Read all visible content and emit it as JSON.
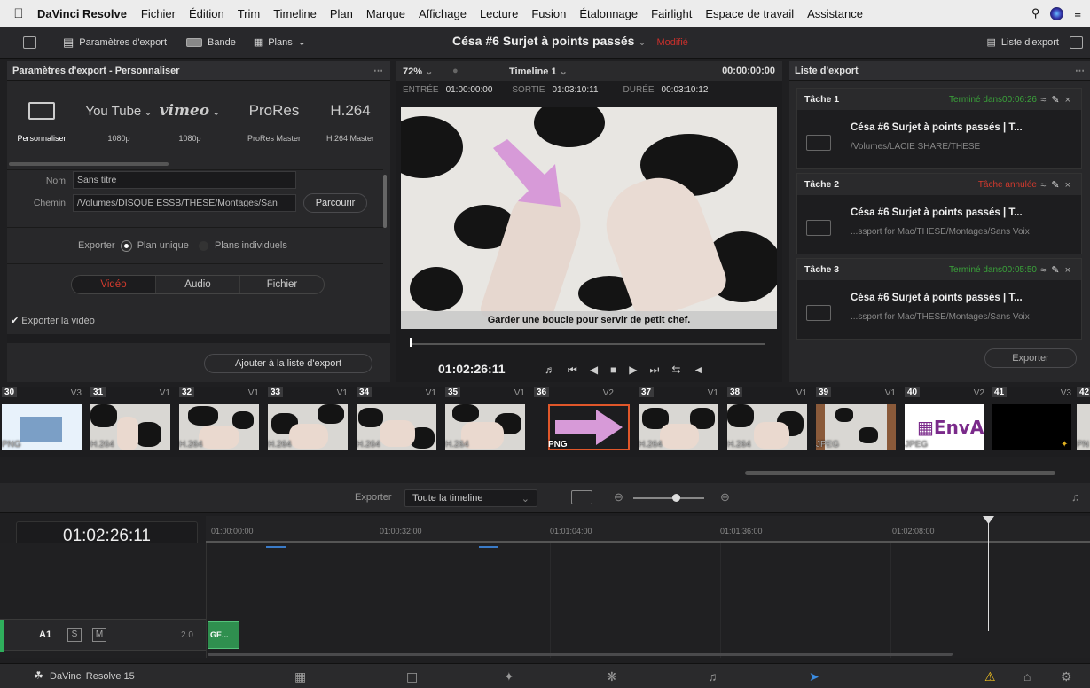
{
  "menubar": {
    "app": "DaVinci Resolve",
    "items": [
      "Fichier",
      "Édition",
      "Trim",
      "Timeline",
      "Plan",
      "Marque",
      "Affichage",
      "Lecture",
      "Fusion",
      "Étalonnage",
      "Fairlight",
      "Espace de travail",
      "Assistance"
    ]
  },
  "toolbar": {
    "export_settings": "Paramètres d'export",
    "tape": "Bande",
    "clips": "Plans",
    "project_title": "Césa #6 Surjet à points passés",
    "modified": "Modifié",
    "export_list": "Liste d'export"
  },
  "left": {
    "header": "Paramètres d'export - Personnaliser",
    "presets": [
      {
        "big": "",
        "small": "Personnaliser"
      },
      {
        "big": "You Tube",
        "small": "1080p"
      },
      {
        "big": "vimeo",
        "small": "1080p"
      },
      {
        "big": "ProRes",
        "small": "ProRes Master"
      },
      {
        "big": "H.264",
        "small": "H.264 Master"
      }
    ],
    "name_label": "Nom",
    "name_value": "Sans titre",
    "path_label": "Chemin",
    "path_value": "/Volumes/DISQUE ESSB/THESE/Montages/San",
    "browse": "Parcourir",
    "export_label": "Exporter",
    "single_clip": "Plan unique",
    "individual_clips": "Plans individuels",
    "tab_video": "Vidéo",
    "tab_audio": "Audio",
    "tab_file": "Fichier",
    "export_video": "Exporter la vidéo",
    "add_to_queue": "Ajouter à la liste d'export"
  },
  "viewer": {
    "zoom": "72%",
    "timeline_name": "Timeline 1",
    "timecode_top": "00:00:00:00",
    "in_label": "ENTRÉE",
    "in_value": "01:00:00:00",
    "out_label": "SORTIE",
    "out_value": "01:03:10:11",
    "dur_label": "DURÉE",
    "dur_value": "00:03:10:12",
    "caption": "Garder une boucle pour servir de petit chef.",
    "timecode": "01:02:26:11"
  },
  "right": {
    "header": "Liste d'export",
    "jobs": [
      {
        "name": "Tâche 1",
        "status": "Terminé dans00:06:26",
        "status_color": "#3aa23a",
        "title": "Césa #6 Surjet à points passés | T...",
        "path": "/Volumes/LACIE SHARE/THESE"
      },
      {
        "name": "Tâche 2",
        "status": "Tâche annulée",
        "status_color": "#d43a2e",
        "title": "Césa #6 Surjet à points passés | T...",
        "path": "...ssport for Mac/THESE/Montages/Sans Voix"
      },
      {
        "name": "Tâche 3",
        "status": "Terminé dans00:05:50",
        "status_color": "#3aa23a",
        "title": "Césa #6 Surjet à points passés | T...",
        "path": "...ssport for Mac/THESE/Montages/Sans Voix"
      }
    ],
    "render": "Exporter"
  },
  "clips": [
    {
      "num": "30",
      "track": "V3",
      "codec": "PNG"
    },
    {
      "num": "31",
      "track": "V1",
      "codec": "H.264"
    },
    {
      "num": "32",
      "track": "V1",
      "codec": "H.264"
    },
    {
      "num": "33",
      "track": "V1",
      "codec": "H.264"
    },
    {
      "num": "34",
      "track": "V1",
      "codec": "H.264"
    },
    {
      "num": "35",
      "track": "V1",
      "codec": "H.264"
    },
    {
      "num": "36",
      "track": "V2",
      "codec": "PNG"
    },
    {
      "num": "37",
      "track": "V1",
      "codec": "H.264"
    },
    {
      "num": "38",
      "track": "V1",
      "codec": "H.264"
    },
    {
      "num": "39",
      "track": "V1",
      "codec": "JPEG"
    },
    {
      "num": "40",
      "track": "V2",
      "codec": "JPEG"
    },
    {
      "num": "41",
      "track": "V3",
      "codec": ""
    },
    {
      "num": "42",
      "track": "",
      "codec": "PN"
    }
  ],
  "exportbar": {
    "label": "Exporter",
    "range": "Toute la timeline"
  },
  "timeline": {
    "timecode": "01:02:26:11",
    "ruler": [
      "01:00:00:00",
      "01:00:32:00",
      "01:01:04:00",
      "01:01:36:00",
      "01:02:08:00"
    ],
    "track_name": "A1",
    "solo": "S",
    "mute": "M",
    "level": "2.0",
    "audio_clip": "GE..."
  },
  "statusbar": {
    "app_version": "DaVinci Resolve 15"
  },
  "logo_text": "EnvA"
}
